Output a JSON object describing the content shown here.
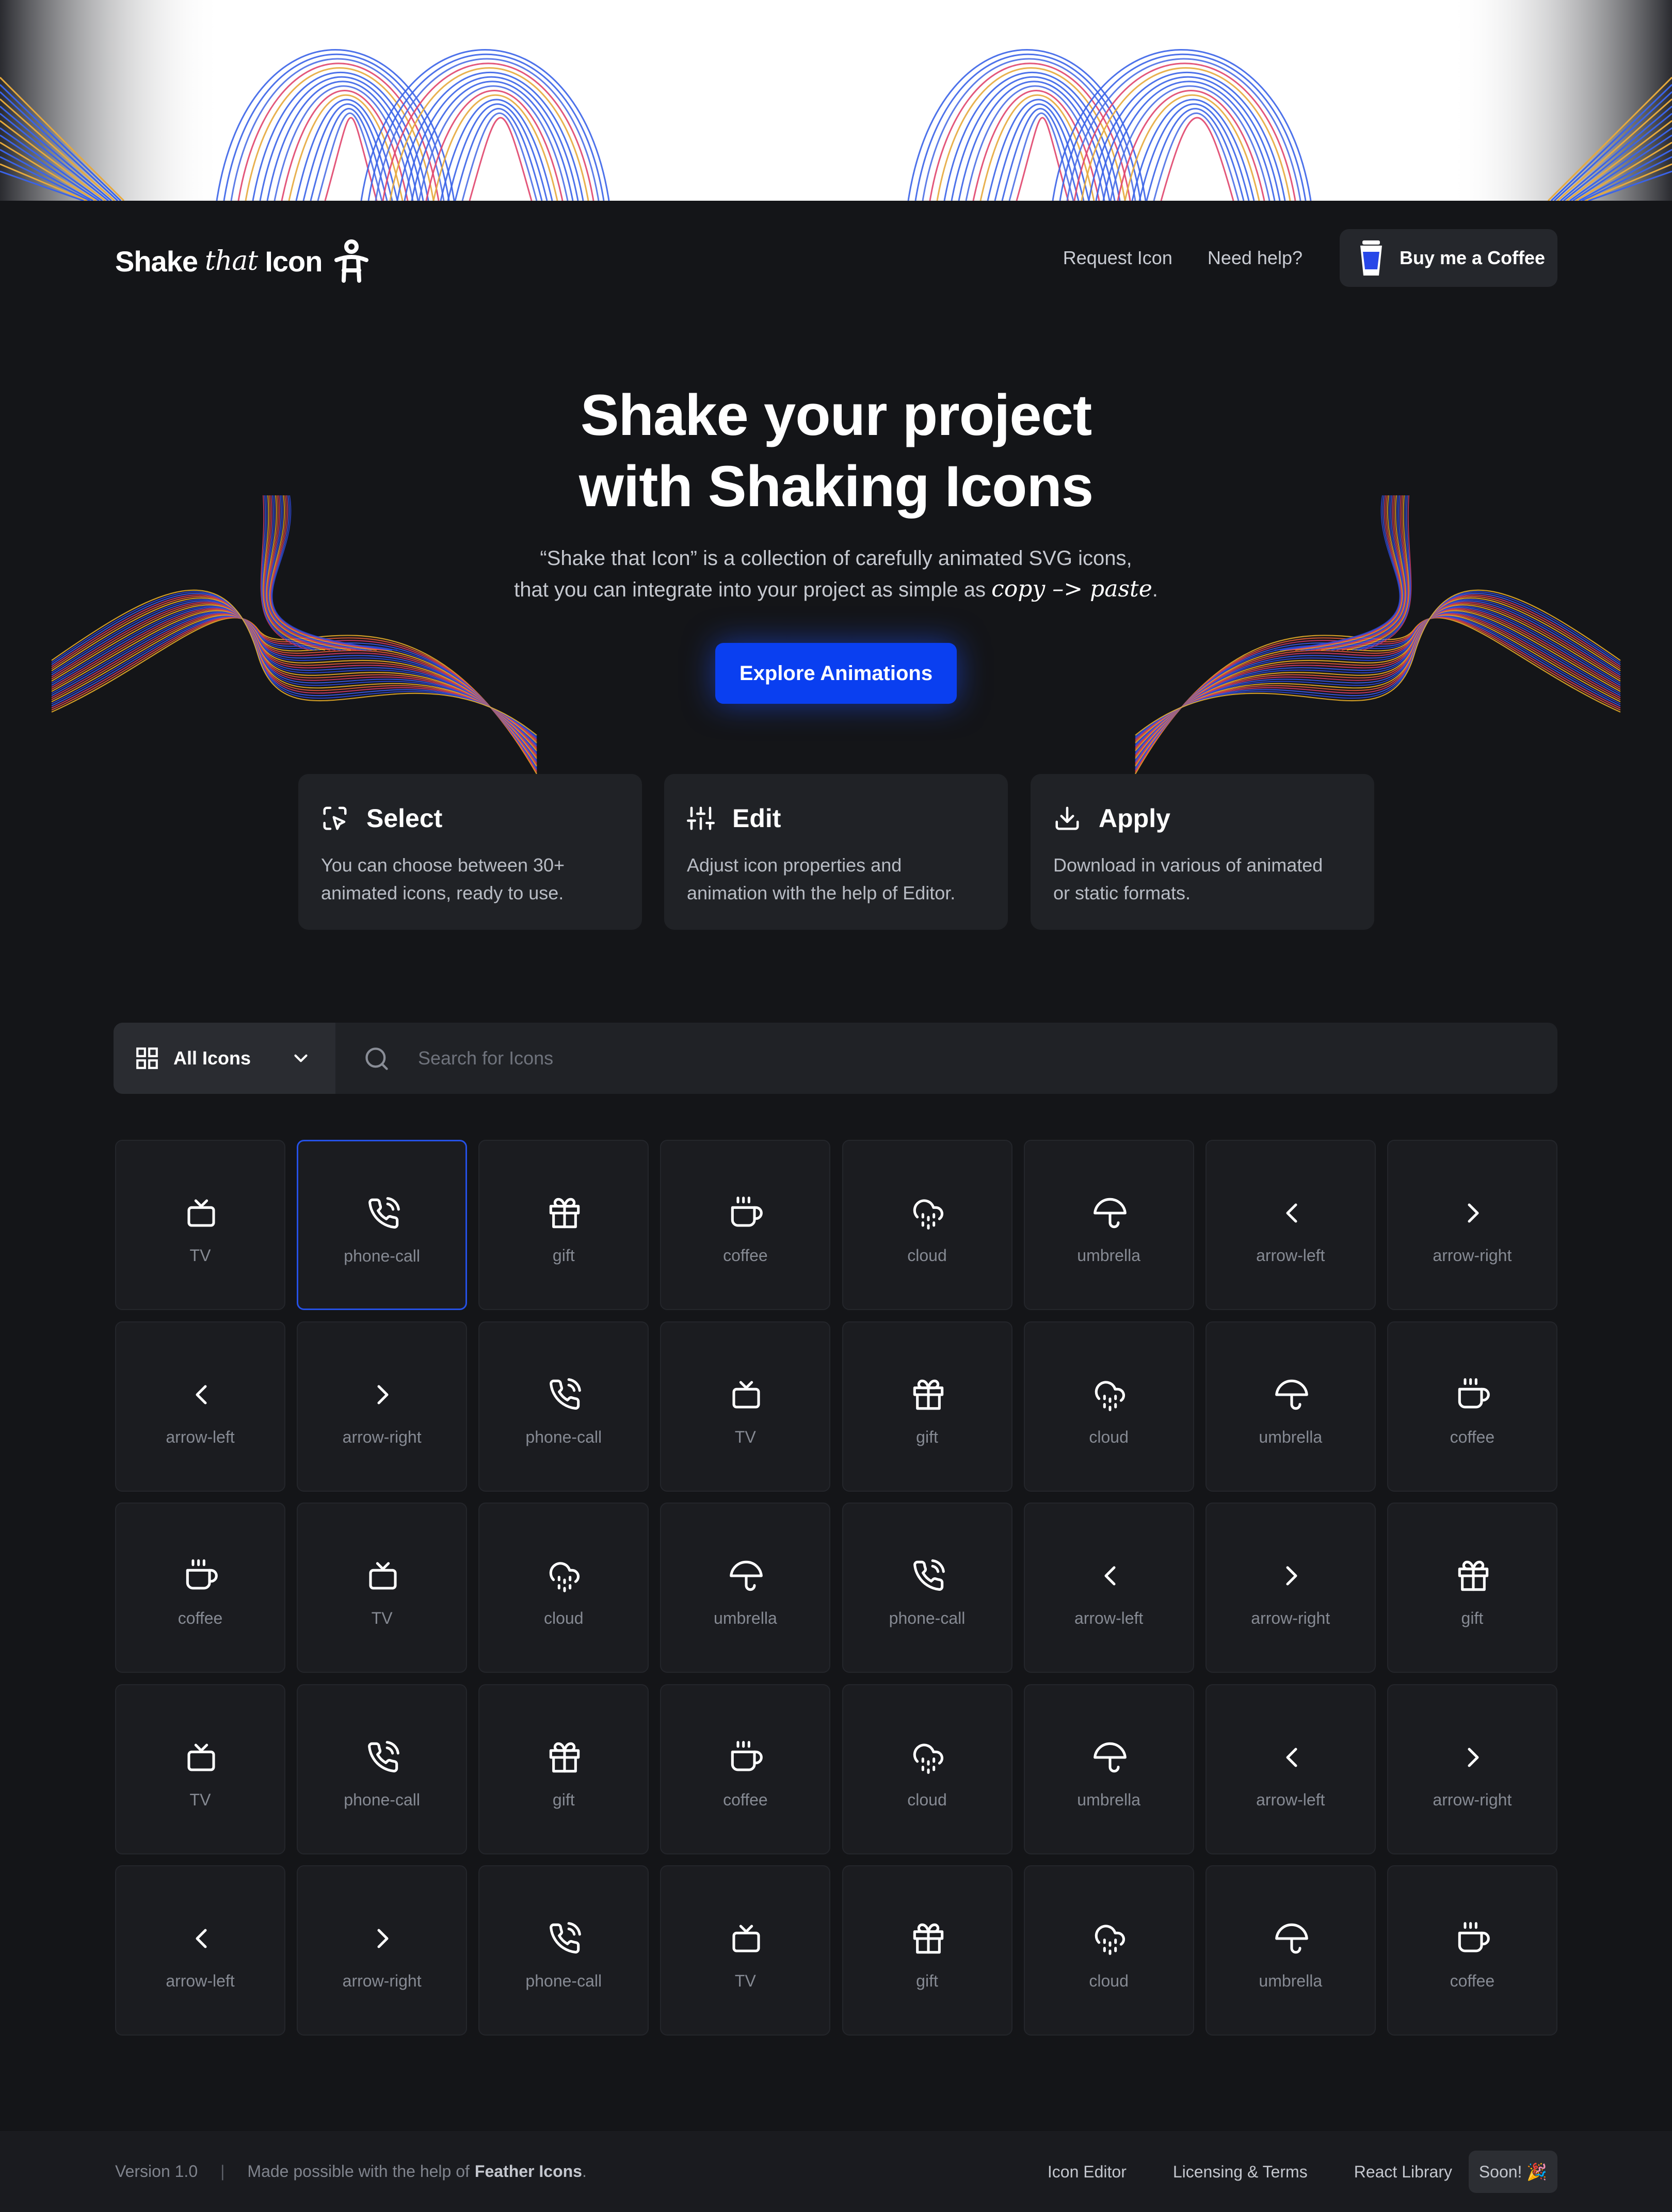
{
  "colors": {
    "background": "#141518",
    "card": "#202226",
    "accent": "#0a3ff0",
    "selected_border": "#2551e6"
  },
  "header": {
    "logo": {
      "word1": "Shake",
      "word2": "that",
      "word3": "Icon",
      "icon": "person-figure-icon"
    },
    "nav": {
      "request": "Request Icon",
      "help": "Need help?"
    },
    "coffee_button": {
      "label": "Buy me a Coffee",
      "icon": "coffee-cup-icon"
    }
  },
  "hero": {
    "title_line1": "Shake your project",
    "title_line2": "with Shaking Icons",
    "subtitle_line1": "“Shake that Icon” is a collection of carefully animated SVG icons,",
    "subtitle_line2": "that you can integrate into your project as simple as",
    "subtitle_script": "copy –> paste",
    "subtitle_end": ".",
    "cta": "Explore Animations"
  },
  "features": [
    {
      "title": "Select",
      "icon": "select-cursor-icon",
      "line1": "You can choose between 30+",
      "line2": "animated icons, ready to use."
    },
    {
      "title": "Edit",
      "icon": "sliders-icon",
      "line1": "Adjust icon properties and",
      "line2": "animation with the help of Editor."
    },
    {
      "title": "Apply",
      "icon": "download-icon",
      "line1": "Download in various of animated",
      "line2": "or static formats."
    }
  ],
  "search": {
    "filter_label": "All Icons",
    "placeholder": "Search for Icons"
  },
  "grid": [
    [
      "TV",
      "phone-call",
      "gift",
      "coffee",
      "cloud",
      "umbrella",
      "arrow-left",
      "arrow-right"
    ],
    [
      "arrow-left",
      "arrow-right",
      "phone-call",
      "TV",
      "gift",
      "cloud",
      "umbrella",
      "coffee"
    ],
    [
      "coffee",
      "TV",
      "cloud",
      "umbrella",
      "phone-call",
      "arrow-left",
      "arrow-right",
      "gift"
    ],
    [
      "TV",
      "phone-call",
      "gift",
      "coffee",
      "cloud",
      "umbrella",
      "arrow-left",
      "arrow-right"
    ],
    [
      "arrow-left",
      "arrow-right",
      "phone-call",
      "TV",
      "gift",
      "cloud",
      "umbrella",
      "coffee"
    ]
  ],
  "selected_tile": {
    "row": 0,
    "col": 1
  },
  "footer": {
    "version": "Version 1.0",
    "separator": "|",
    "credit_prefix": "Made possible with the help of",
    "credit_name": "Feather Icons",
    "credit_end": ".",
    "links": {
      "editor": "Icon Editor",
      "licensing": "Licensing & Terms",
      "react": "React Library"
    },
    "soon": "Soon! 🎉"
  }
}
